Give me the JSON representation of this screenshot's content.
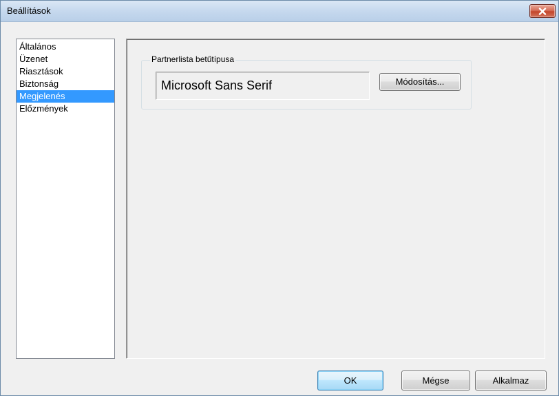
{
  "window": {
    "title": "Beállítások",
    "close_icon": "close-icon"
  },
  "sidebar": {
    "items": [
      {
        "label": "Általános",
        "selected": false
      },
      {
        "label": "Üzenet",
        "selected": false
      },
      {
        "label": "Riasztások",
        "selected": false
      },
      {
        "label": "Biztonság",
        "selected": false
      },
      {
        "label": "Megjelenés",
        "selected": true
      },
      {
        "label": "Előzmények",
        "selected": false
      }
    ]
  },
  "panel": {
    "group_title": "Partnerlista betűtípusa",
    "font_name": "Microsoft Sans Serif",
    "modify_label": "Módosítás..."
  },
  "footer": {
    "ok_label": "OK",
    "cancel_label": "Mégse",
    "apply_label": "Alkalmaz"
  },
  "colors": {
    "selection": "#3399ff",
    "close_button": "#c4452a"
  }
}
